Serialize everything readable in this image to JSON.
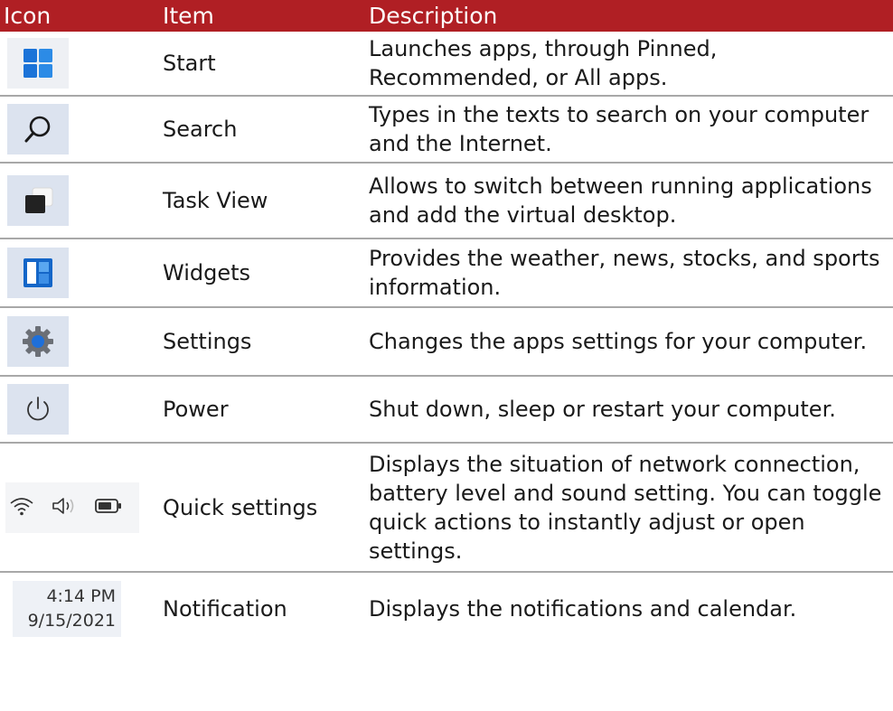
{
  "headers": {
    "icon": "Icon",
    "item": "Item",
    "description": "Description"
  },
  "colors": {
    "header_bg": "#b01f24",
    "icon_bg": "#dce3ef",
    "accent_blue": "#1e6fd9"
  },
  "rows": [
    {
      "icon": "windows-start-icon",
      "item": "Start",
      "description": "Launches apps, through Pinned, Recommended, or All apps."
    },
    {
      "icon": "search-icon",
      "item": "Search",
      "description": "Types in the texts to search on your computer and the Internet."
    },
    {
      "icon": "task-view-icon",
      "item": "Task View",
      "description": "Allows to switch between running applications and add the virtual desktop."
    },
    {
      "icon": "widgets-icon",
      "item": "Widgets",
      "description": "Provides the weather, news, stocks, and sports information."
    },
    {
      "icon": "gear-icon",
      "item": "Settings",
      "description": "Changes the apps settings for your computer."
    },
    {
      "icon": "power-icon",
      "item": "Power",
      "description": "Shut down, sleep or restart your computer."
    },
    {
      "icon": "quick-settings-icons",
      "item": "Quick settings",
      "description": "Displays the situation of network connection, battery level and sound setting. You can toggle quick actions to instantly adjust or open settings."
    },
    {
      "icon": "clock-icon",
      "item": "Notification",
      "description": "Displays the notifications and calendar.",
      "clock": {
        "time": "4:14 PM",
        "date": "9/15/2021"
      }
    }
  ]
}
